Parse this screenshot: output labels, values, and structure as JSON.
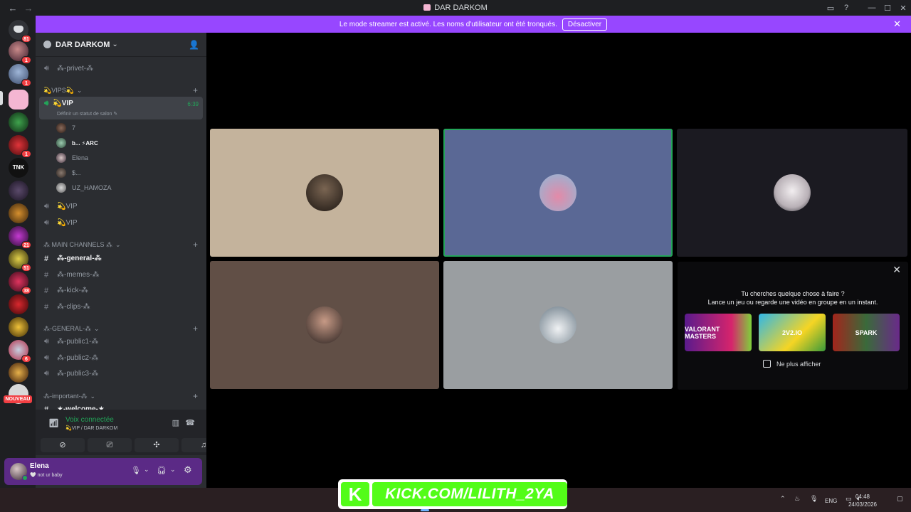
{
  "window": {
    "title": "DAR DARKOM",
    "back": "←",
    "forward": "→",
    "controls": [
      "▭",
      "?",
      "—",
      "☐",
      "✕"
    ]
  },
  "banner": {
    "text": "Le mode streamer est activé. Les noms d'utilisateur ont été tronqués.",
    "button": "Désactiver",
    "close": "✕"
  },
  "guilds": {
    "home_badge": "81",
    "badges": [
      "1",
      "1",
      "1",
      "21",
      "51",
      "38",
      "6"
    ],
    "new_label": "NOUVEAU"
  },
  "server": {
    "name": "DAR DARKOM",
    "chevron": "⌄"
  },
  "channels": {
    "privet": "⁂-privet-⁂",
    "cat_vips": "💫VIPS💫",
    "vip_active": {
      "name": "💫VIP",
      "timer": "6:39",
      "status": "Définir un statut de salon ✎"
    },
    "members": [
      "7",
      "b... ⚡ARC",
      "Elena",
      "$...",
      "UZ_HAMOZA"
    ],
    "vip2": "💫VIP",
    "vip3": "💫VIP",
    "cat_main": "⁂ MAIN CHANNELS ⁂",
    "general": "⁂-general-⁂",
    "memes": "⁂-memes-⁂",
    "kick": "⁂-kick-⁂",
    "clips": "⁂-clips-⁂",
    "cat_general": "⁂-GENERAL-⁂",
    "public1": "⁂-public1-⁂",
    "public2": "⁂-public2-⁂",
    "public3": "⁂-public3-⁂",
    "cat_important": "⁂-important-⁂",
    "welcome": "★-welcome-★"
  },
  "voice": {
    "connected": "Voix connectée",
    "location": "💫VIP / DAR DARKOM"
  },
  "user": {
    "name": "Elena",
    "status": "🤍 not ur baby"
  },
  "activity": {
    "line1": "Tu cherches quelque chose à faire ?",
    "line2": "Lance un jeu ou regarde une vidéo en groupe en un instant.",
    "games": [
      "VALORANT MASTERS",
      "2V2.IO",
      "SPARK"
    ],
    "checkbox": "Ne plus afficher"
  },
  "overlay": {
    "k": "K",
    "url": "KICK.COM/LILITH_2YA"
  },
  "tray": {
    "lang": "ENG",
    "time": "04:48",
    "date": "24/03/2026"
  },
  "colors": {
    "accent": "#9747ff",
    "online": "#23a559",
    "danger": "#f23f43",
    "kick": "#53fc18"
  }
}
